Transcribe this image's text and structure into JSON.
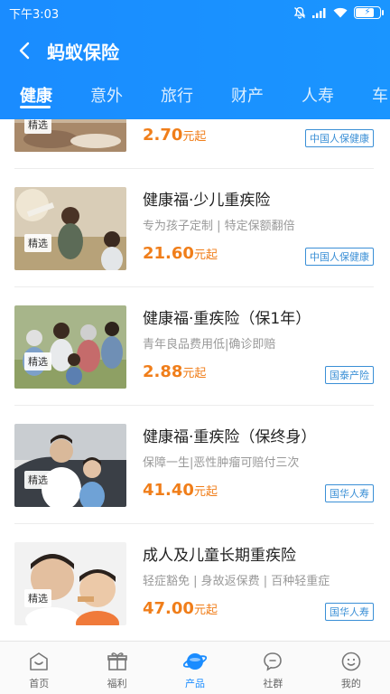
{
  "status_bar": {
    "time": "下午3:03"
  },
  "header": {
    "title": "蚂蚁保险",
    "tabs": [
      {
        "label": "健康",
        "active": true
      },
      {
        "label": "意外",
        "active": false
      },
      {
        "label": "旅行",
        "active": false
      },
      {
        "label": "财产",
        "active": false
      },
      {
        "label": "人寿",
        "active": false
      },
      {
        "label": "车",
        "active": false
      }
    ]
  },
  "products": [
    {
      "name": "",
      "subtitle": "",
      "price": "2.70",
      "price_unit": "元起",
      "company": "中国人保健康",
      "badge": "精选",
      "image": "family-on-floor"
    },
    {
      "name": "健康福·少儿重疾险",
      "subtitle": "专为孩子定制 | 特定保额翻倍",
      "price": "21.60",
      "price_unit": "元起",
      "company": "中国人保健康",
      "badge": "精选",
      "image": "girl-with-plane"
    },
    {
      "name": "健康福·重疾险（保1年）",
      "subtitle": "青年良品费用低|确诊即赔",
      "price": "2.88",
      "price_unit": "元起",
      "company": "国泰产险",
      "badge": "精选",
      "image": "family-outdoor"
    },
    {
      "name": "健康福·重疾险（保终身）",
      "subtitle": "保障一生|恶性肿瘤可赔付三次",
      "price": "41.40",
      "price_unit": "元起",
      "company": "国华人寿",
      "badge": "精选",
      "image": "father-daughter-car"
    },
    {
      "name": "成人及儿童长期重疾险",
      "subtitle": "轻症豁免 | 身故返保费 | 百种轻重症",
      "price": "47.00",
      "price_unit": "元起",
      "company": "国华人寿",
      "badge": "精选",
      "image": "father-son-eating"
    }
  ],
  "bottom_nav": [
    {
      "label": "首页",
      "icon": "home-icon",
      "active": false
    },
    {
      "label": "福利",
      "icon": "gift-icon",
      "active": false
    },
    {
      "label": "产品",
      "icon": "planet-icon",
      "active": true
    },
    {
      "label": "社群",
      "icon": "chat-icon",
      "active": false
    },
    {
      "label": "我的",
      "icon": "smile-icon",
      "active": false
    }
  ],
  "colors": {
    "brand_blue": "#1a8cff",
    "price_orange": "#f07e1a",
    "company_blue": "#3a8fd6"
  }
}
